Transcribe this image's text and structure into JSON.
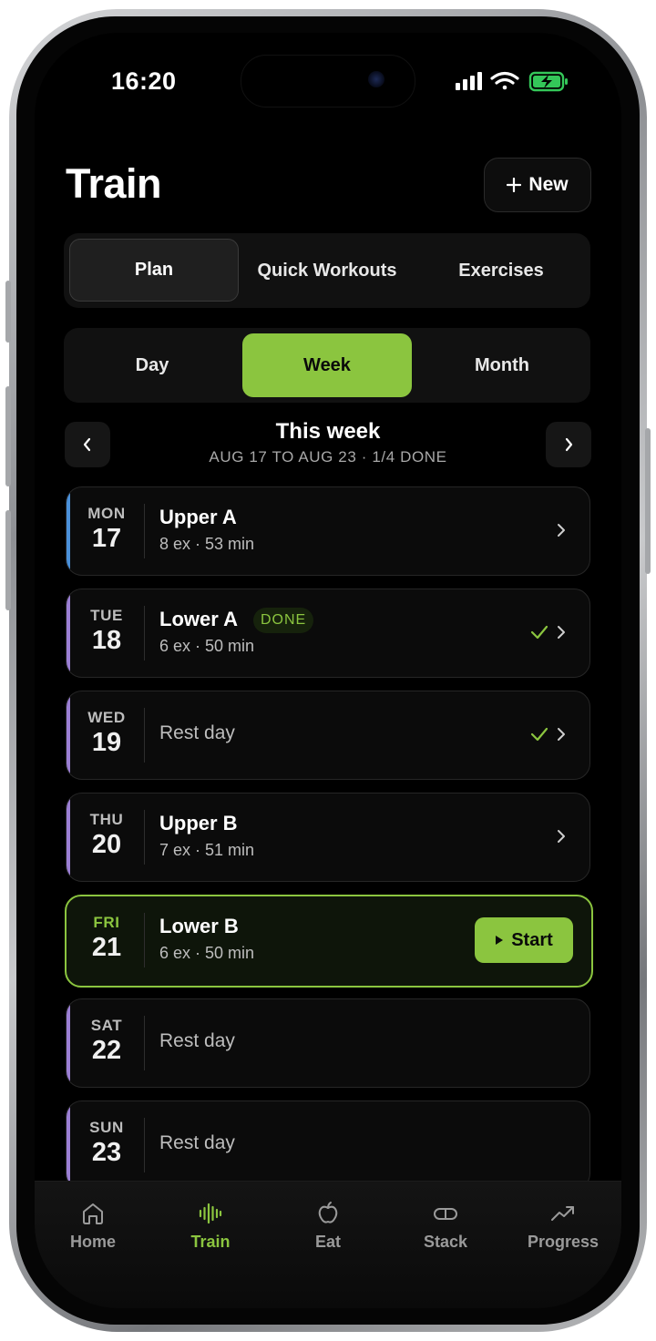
{
  "status_bar": {
    "time": "16:20"
  },
  "header": {
    "title": "Train",
    "new_button_label": "New",
    "new_button_icon": "plus-icon"
  },
  "main_tabs": [
    {
      "label": "Plan",
      "active": true
    },
    {
      "label": "Quick Workouts",
      "active": false
    },
    {
      "label": "Exercises",
      "active": false
    }
  ],
  "range_tabs": [
    {
      "label": "Day",
      "active": false
    },
    {
      "label": "Week",
      "active": true
    },
    {
      "label": "Month",
      "active": false
    }
  ],
  "week_nav": {
    "title": "This week",
    "subtitle": "AUG 17 TO AUG 23 · 1/4 DONE"
  },
  "schedule": [
    {
      "day": "MON",
      "date": "17",
      "name": "Upper A",
      "meta": "8 ex · 53 min",
      "rest": false,
      "done": false,
      "checked": false,
      "today": false,
      "accent": "#4a90d9"
    },
    {
      "day": "TUE",
      "date": "18",
      "name": "Lower A",
      "meta": "6 ex · 50 min",
      "rest": false,
      "done": true,
      "done_label": "DONE",
      "checked": true,
      "today": false,
      "accent": "#9b7fd4"
    },
    {
      "day": "WED",
      "date": "19",
      "rest_label": "Rest day",
      "rest": true,
      "checked": true,
      "today": false,
      "accent": "#9b7fd4"
    },
    {
      "day": "THU",
      "date": "20",
      "name": "Upper B",
      "meta": "7 ex · 51 min",
      "rest": false,
      "done": false,
      "checked": false,
      "today": false,
      "accent": "#9b7fd4"
    },
    {
      "day": "FRI",
      "date": "21",
      "name": "Lower B",
      "meta": "6 ex · 50 min",
      "rest": false,
      "done": false,
      "checked": false,
      "today": true,
      "start_label": "Start",
      "accent": "#8bc53f"
    },
    {
      "day": "SAT",
      "date": "22",
      "rest_label": "Rest day",
      "rest": true,
      "checked": false,
      "today": false,
      "accent": "#9b7fd4"
    },
    {
      "day": "SUN",
      "date": "23",
      "rest_label": "Rest day",
      "rest": true,
      "checked": false,
      "today": false,
      "accent": "#9b7fd4"
    }
  ],
  "tab_bar": [
    {
      "label": "Home",
      "icon": "home-icon",
      "active": false
    },
    {
      "label": "Train",
      "icon": "waveform-icon",
      "active": true
    },
    {
      "label": "Eat",
      "icon": "apple-icon",
      "active": false
    },
    {
      "label": "Stack",
      "icon": "pill-icon",
      "active": false
    },
    {
      "label": "Progress",
      "icon": "trend-up-icon",
      "active": false
    }
  ],
  "colors": {
    "accent": "#8bc53f",
    "background": "#000000",
    "card": "#0b0b0b",
    "blue_accent": "#4a90d9",
    "purple_accent": "#9b7fd4"
  }
}
